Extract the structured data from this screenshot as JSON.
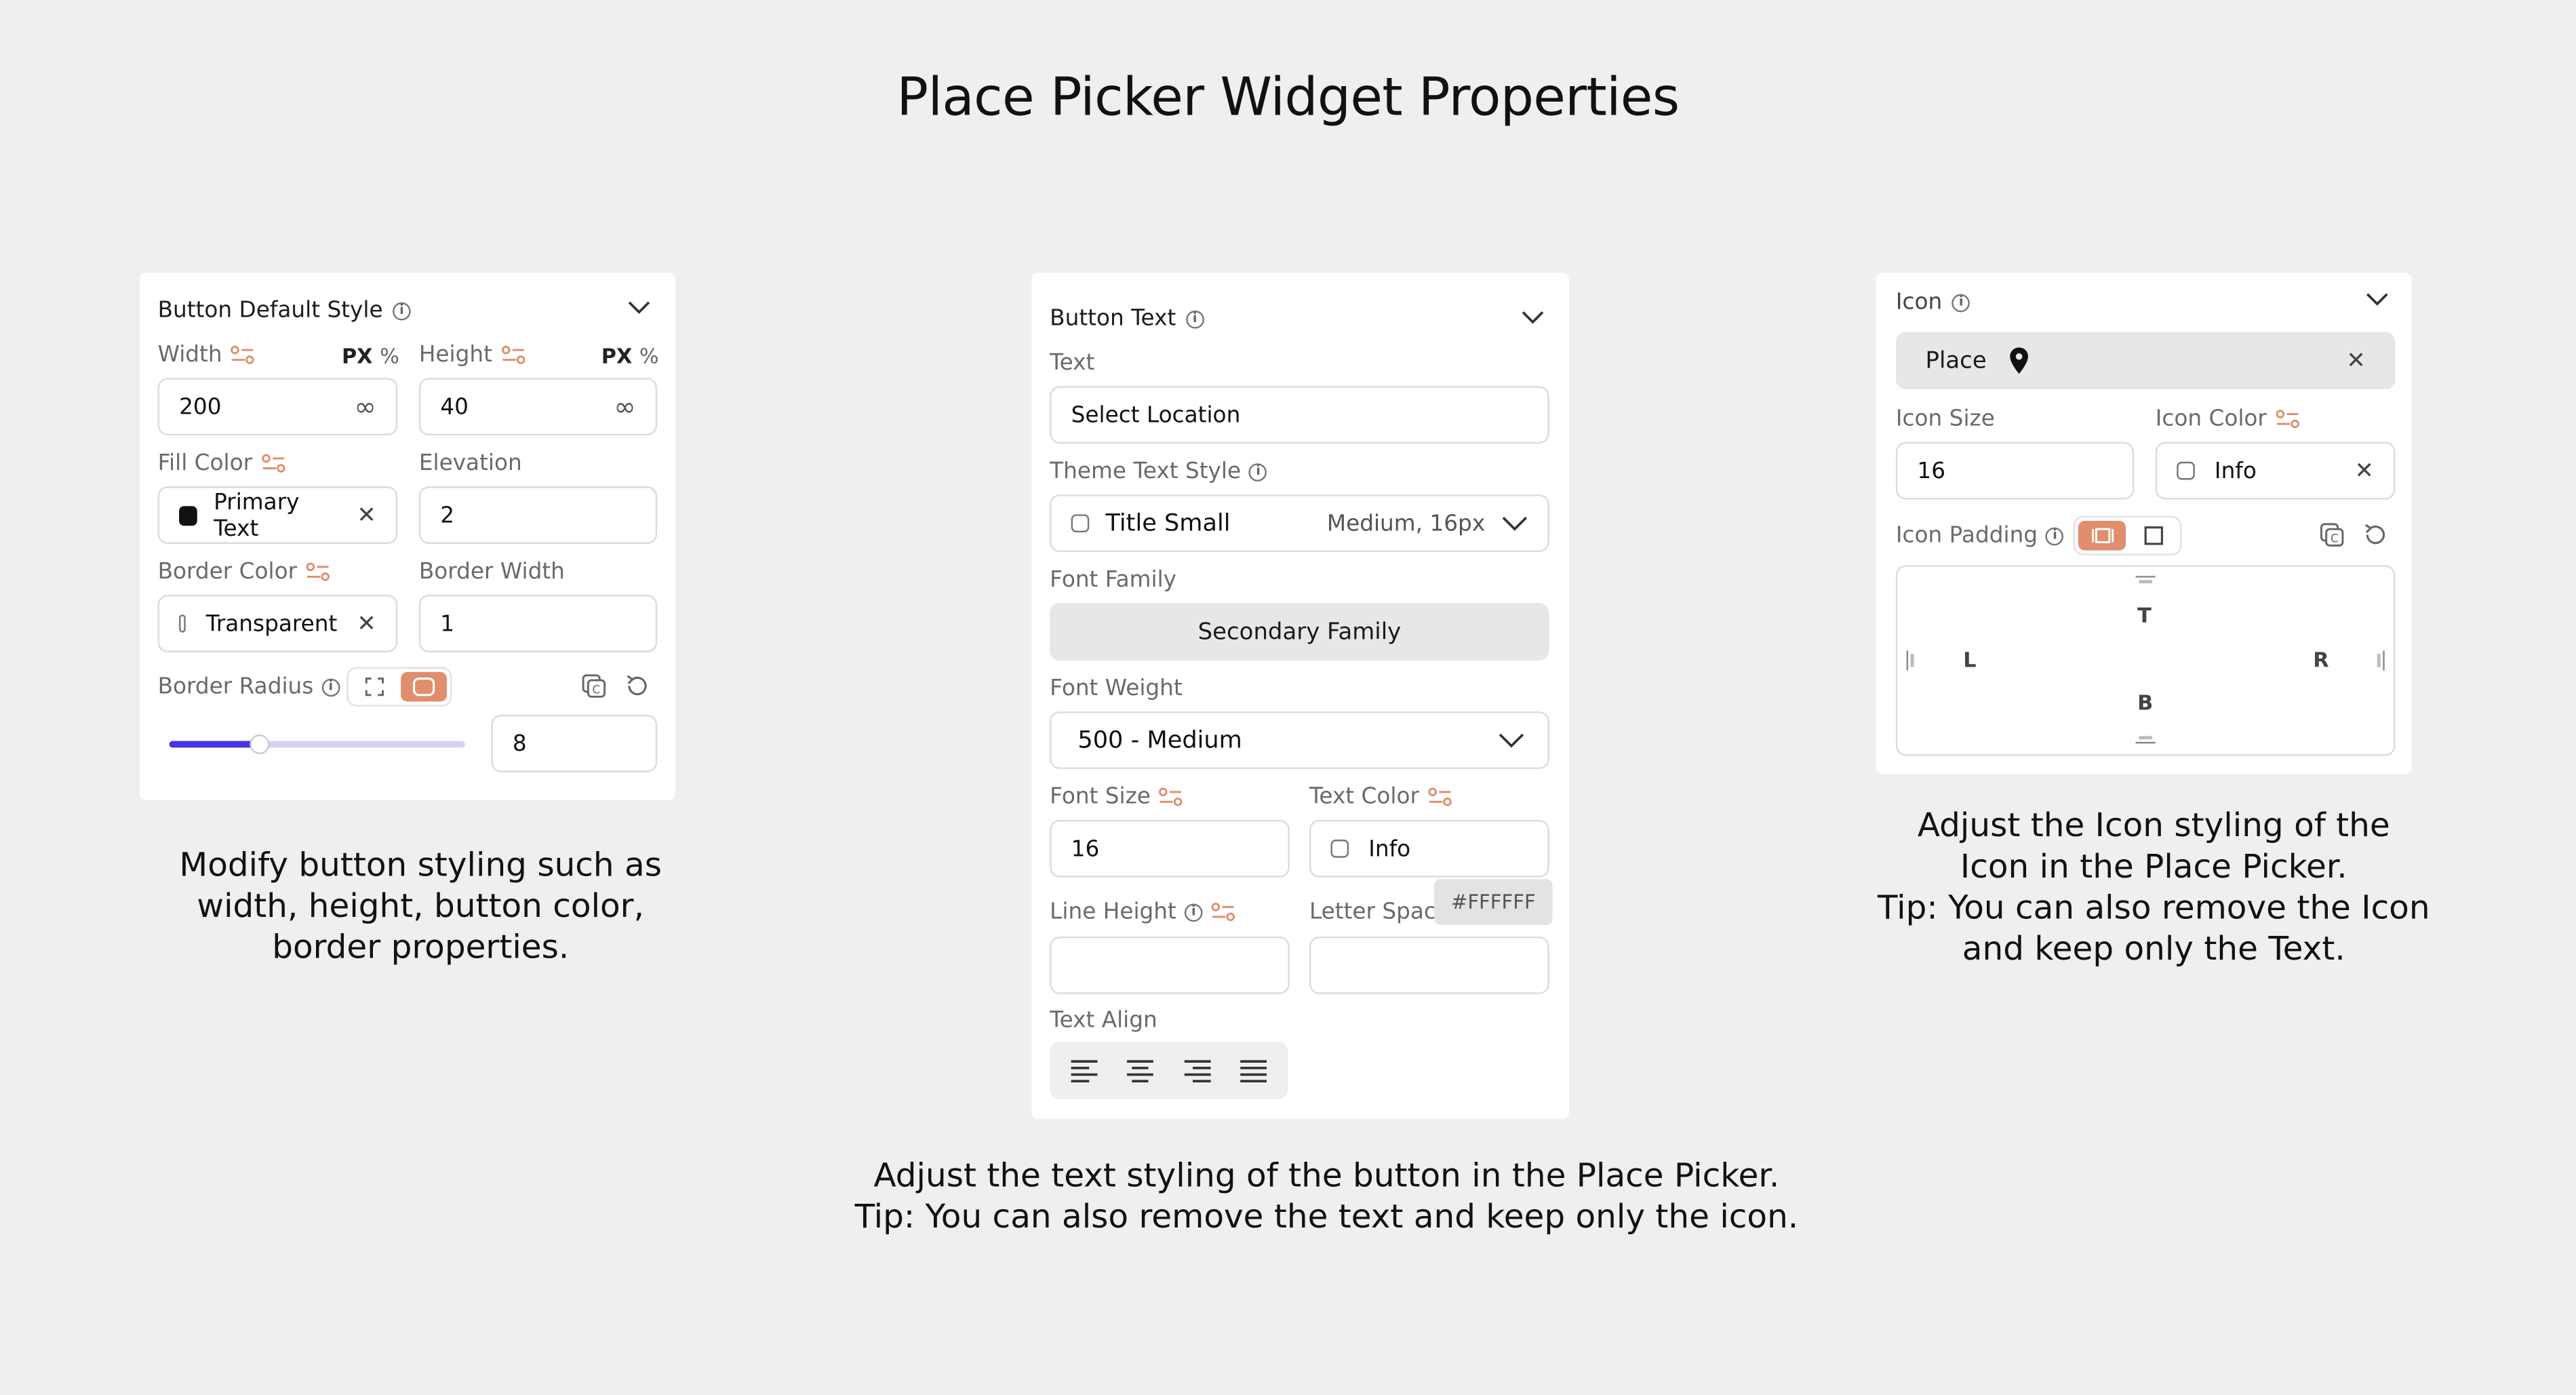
{
  "page_title": "Place Picker Widget Properties",
  "colors": {
    "accent": "#e08e6d",
    "slider": "#4535e0",
    "background": "#efefef"
  },
  "panel1": {
    "header": "Button Default Style",
    "width_label": "Width",
    "width_unit_px": "PX",
    "width_unit_pct": "%",
    "width_value": "200",
    "height_label": "Height",
    "height_unit_px": "PX",
    "height_unit_pct": "%",
    "height_value": "40",
    "infinity_symbol": "∞",
    "fill_color_label": "Fill Color",
    "fill_color_value": "Primary Text",
    "elevation_label": "Elevation",
    "elevation_value": "2",
    "border_color_label": "Border Color",
    "border_color_value": "Transparent",
    "border_width_label": "Border Width",
    "border_width_value": "1",
    "border_radius_label": "Border Radius",
    "border_radius_value": "8",
    "border_radius_slider_fraction": 0.3
  },
  "panel2": {
    "header": "Button Text",
    "text_label": "Text",
    "text_value": "Select Location",
    "theme_text_style_label": "Theme Text Style",
    "theme_style_value": "Title Small",
    "theme_style_meta": "Medium, 16px",
    "font_family_label": "Font Family",
    "font_family_value": "Secondary Family",
    "font_weight_label": "Font Weight",
    "font_weight_value": "500 - Medium",
    "font_size_label": "Font Size",
    "font_size_value": "16",
    "text_color_label": "Text Color",
    "text_color_value": "Info",
    "line_height_label": "Line Height",
    "line_height_value": "",
    "letter_spacing_label": "Letter Spaci",
    "letter_spacing_value": "",
    "tooltip": "#FFFFFF",
    "text_align_label": "Text Align",
    "align_options": [
      "align-left",
      "align-center",
      "align-right",
      "align-justify"
    ]
  },
  "panel3": {
    "header": "Icon",
    "icon_value": "Place",
    "icon_size_label": "Icon Size",
    "icon_size_value": "16",
    "icon_color_label": "Icon Color",
    "icon_color_value": "Info",
    "icon_padding_label": "Icon Padding",
    "pad_top": "T",
    "pad_left": "L",
    "pad_right": "R",
    "pad_bottom": "B"
  },
  "captions": {
    "left": [
      "Modify button styling such as",
      "width, height, button color,",
      "border properties."
    ],
    "middle": [
      "Adjust the text styling of the button in the Place Picker.",
      "Tip: You can also remove the text and keep only the icon."
    ],
    "right": [
      "Adjust the Icon styling of the",
      "Icon in the Place Picker.",
      "Tip: You can also remove the Icon",
      "and keep only the Text."
    ]
  }
}
